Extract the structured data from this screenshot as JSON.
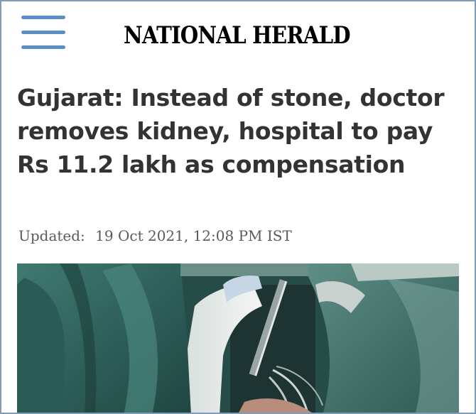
{
  "header": {
    "menu_icon": "hamburger-menu-icon",
    "logo_text": "NATIONAL HERALD"
  },
  "article": {
    "headline": "Gujarat: Instead of stone, doctor removes kidney, hospital to pay Rs 11.2 lakh as compensation",
    "updated_label": "Updated:",
    "updated_time": "19 Oct 2021, 12:08 PM IST"
  },
  "image": {
    "subject": "surgery-photo"
  },
  "colors": {
    "menu_icon": "#5b8ec4",
    "headline": "#333333",
    "updated_text": "#5a5a5a",
    "frame_border": "#7f9cb8"
  }
}
